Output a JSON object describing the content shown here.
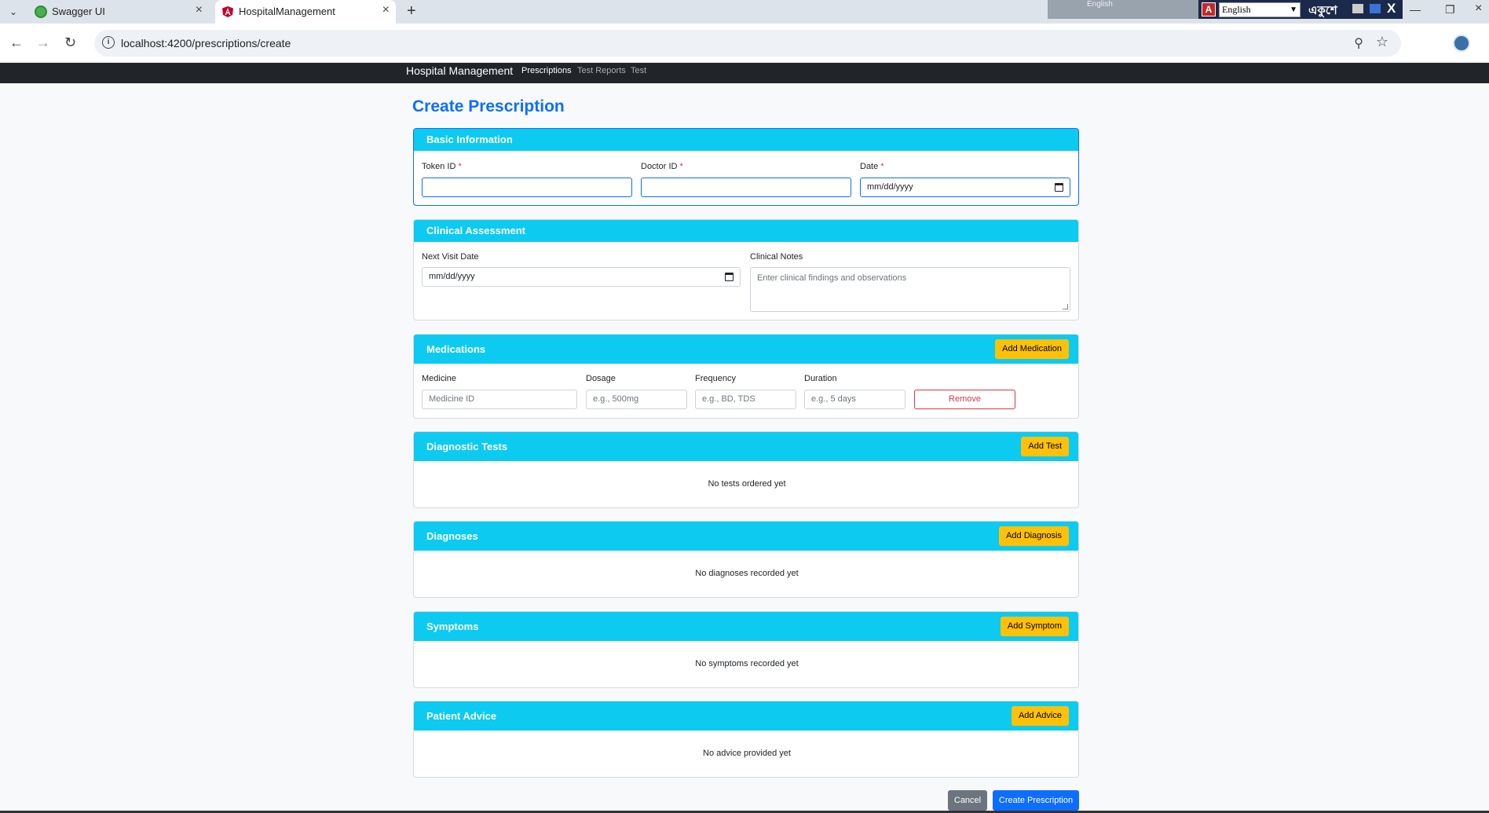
{
  "browser": {
    "tabs": [
      {
        "title": "Swagger UI",
        "active": false,
        "favicon": "swagger-icon"
      },
      {
        "title": "HospitalManagement",
        "active": true,
        "favicon": "angular-icon"
      }
    ],
    "url": "localhost:4200/prescriptions/create",
    "language_bar": {
      "strip_label": "English",
      "selected_language": "English",
      "script_label": "একুশে"
    }
  },
  "navbar": {
    "brand": "Hospital Management",
    "links": [
      "Prescriptions",
      "Test Reports",
      "Test"
    ],
    "active_link": "Prescriptions"
  },
  "page": {
    "title": "Create Prescription"
  },
  "basic_info": {
    "header": "Basic Information",
    "token_label": "Token ID",
    "doctor_label": "Doctor ID",
    "date_label": "Date",
    "required_mark": "*",
    "date_placeholder": "mm/dd/yyyy"
  },
  "clinical": {
    "header": "Clinical Assessment",
    "next_visit_label": "Next Visit Date",
    "next_visit_placeholder": "mm/dd/yyyy",
    "notes_label": "Clinical Notes",
    "notes_placeholder": "Enter clinical findings and observations"
  },
  "medications": {
    "header": "Medications",
    "add_label": "Add Medication",
    "medicine_label": "Medicine",
    "medicine_placeholder": "Medicine ID",
    "dosage_label": "Dosage",
    "dosage_placeholder": "e.g., 500mg",
    "frequency_label": "Frequency",
    "frequency_placeholder": "e.g., BD, TDS",
    "duration_label": "Duration",
    "duration_placeholder": "e.g., 5 days",
    "remove_label": "Remove"
  },
  "tests": {
    "header": "Diagnostic Tests",
    "add_label": "Add Test",
    "empty_text": "No tests ordered yet"
  },
  "diagnoses": {
    "header": "Diagnoses",
    "add_label": "Add Diagnosis",
    "empty_text": "No diagnoses recorded yet"
  },
  "symptoms": {
    "header": "Symptoms",
    "add_label": "Add Symptom",
    "empty_text": "No symptoms recorded yet"
  },
  "advice": {
    "header": "Patient Advice",
    "add_label": "Add Advice",
    "empty_text": "No advice provided yet"
  },
  "actions": {
    "cancel_label": "Cancel",
    "submit_label": "Create Prescription"
  },
  "colors": {
    "primary": "#0d6efd",
    "info": "#0dcaf0",
    "warning": "#ffc107",
    "danger": "#dc3545",
    "secondary": "#6c757d",
    "navbar": "#212529"
  }
}
